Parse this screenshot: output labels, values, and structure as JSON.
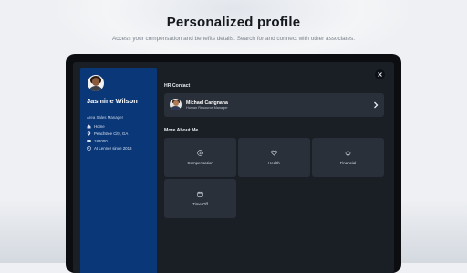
{
  "hero": {
    "title": "Personalized profile",
    "subtitle": "Access your compensation and benefits details. Search for and connect with other associates."
  },
  "profile": {
    "name": "Jasmine Wilson",
    "title": "Area Sales Manager",
    "meta": [
      {
        "icon": "home-icon",
        "text": "Home"
      },
      {
        "icon": "location-pin-icon",
        "text": "Peachtree City, GA"
      },
      {
        "icon": "id-card-icon",
        "text": "182000"
      },
      {
        "icon": "clock-icon",
        "text": "At Lenner since 2018"
      }
    ]
  },
  "hr_contact": {
    "heading": "HR Contact",
    "name": "Michael Carignana",
    "role": "Human Resource Manager"
  },
  "more_about": {
    "heading": "More About Me",
    "tiles": [
      {
        "label": "Compensation",
        "icon": "dollar-circle-icon"
      },
      {
        "label": "Health",
        "icon": "heart-icon"
      },
      {
        "label": "Financial",
        "icon": "piggy-bank-icon"
      },
      {
        "label": "Time Off",
        "icon": "calendar-icon"
      }
    ]
  },
  "colors": {
    "sidebar": "#0a3778",
    "panel": "#1a1f26",
    "card": "#2a3039"
  }
}
